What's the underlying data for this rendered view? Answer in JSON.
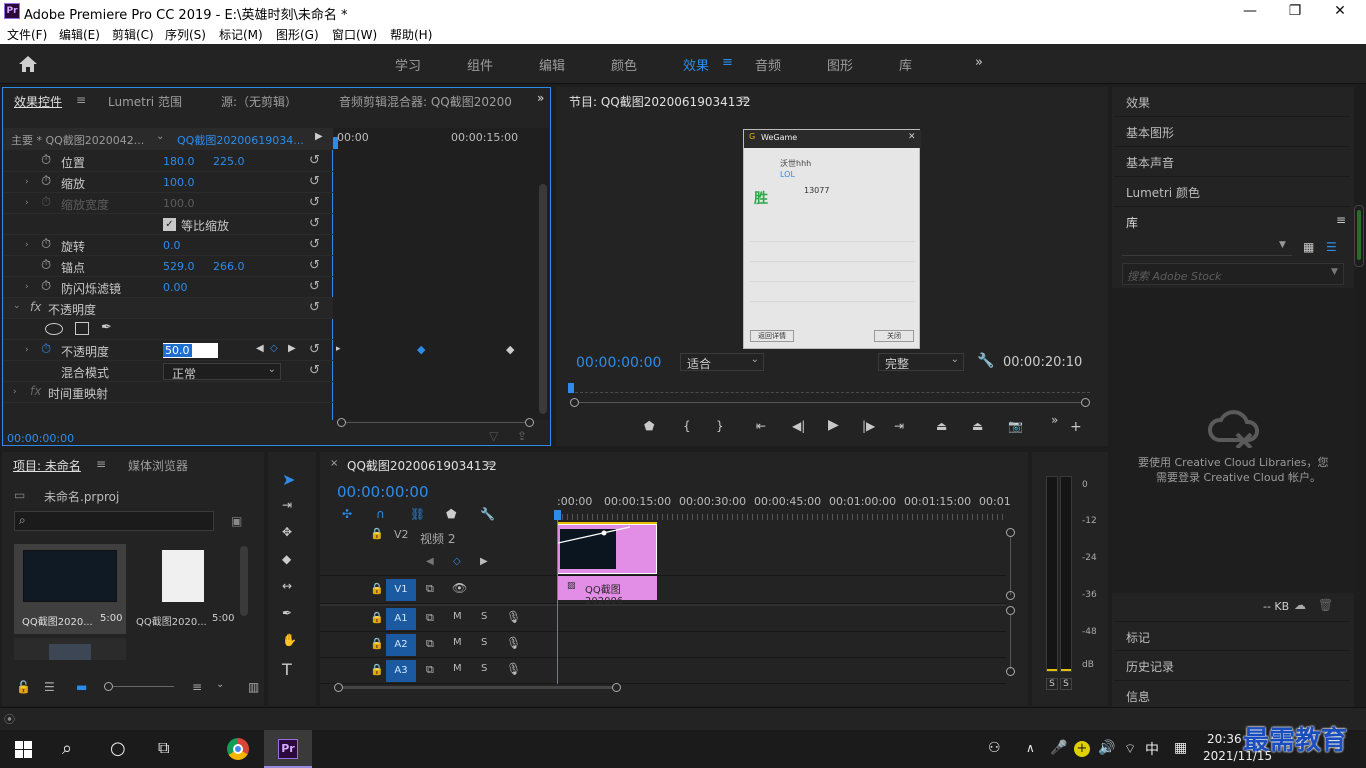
{
  "app": {
    "title": "Adobe Premiere Pro CC 2019 - E:\\英雄时刻\\未命名 *",
    "logo": "Pr"
  },
  "window": {
    "minimize": "—",
    "maximize": "❐",
    "close": "✕"
  },
  "menu": [
    "文件(F)",
    "编辑(E)",
    "剪辑(C)",
    "序列(S)",
    "标记(M)",
    "图形(G)",
    "窗口(W)",
    "帮助(H)"
  ],
  "workspaces": [
    "学习",
    "组件",
    "编辑",
    "颜色",
    "效果",
    "音频",
    "图形",
    "库"
  ],
  "workspace_active": "效果",
  "effect_controls": {
    "tabs": [
      "效果控件",
      "Lumetri 范围",
      "源:（无剪辑）",
      "音频剪辑混合器: QQ截图20200"
    ],
    "master": "主要 * QQ截图2020042...",
    "clip": "QQ截图20200619034...",
    "time_start": "00:00",
    "time_end": "00:00:15:00",
    "rows": [
      {
        "label": "位置",
        "v1": "180.0",
        "v2": "225.0"
      },
      {
        "label": "缩放",
        "v1": "100.0",
        "v2": ""
      },
      {
        "label": "缩放宽度",
        "v1": "100.0",
        "v2": ""
      },
      {
        "label": "等比缩放",
        "v1": "",
        "v2": ""
      },
      {
        "label": "旋转",
        "v1": "0.0",
        "v2": ""
      },
      {
        "label": "锚点",
        "v1": "529.0",
        "v2": "266.0"
      },
      {
        "label": "防闪烁滤镜",
        "v1": "0.00",
        "v2": ""
      }
    ],
    "opacity_section": "不透明度",
    "opacity_label": "不透明度",
    "opacity_value": "50.0",
    "blend_label": "混合模式",
    "blend_value": "正常",
    "time_remap": "时间重映射",
    "timecode": "00:00:00:00"
  },
  "program": {
    "title": "节目: QQ截图20200619034132",
    "timecode": "00:00:00:00",
    "fit": "适合",
    "quality": "完整",
    "duration": "00:00:20:10",
    "preview": {
      "app": "WeGame",
      "user": "沃世hhh",
      "mode": "LOL",
      "result": "胜",
      "score": "13077",
      "buttons": [
        "返回详情",
        "关闭"
      ]
    }
  },
  "right_panel": {
    "items": [
      "效果",
      "基本图形",
      "基本声音",
      "Lumetri 颜色",
      "库"
    ],
    "search_placeholder": "搜索 Adobe Stock",
    "cc_msg_line1": "要使用 Creative Cloud Libraries，您",
    "cc_msg_line2": "需要登录 Creative Cloud 帐户。",
    "kb": "-- KB",
    "bottom": [
      "标记",
      "历史记录",
      "信息"
    ]
  },
  "project": {
    "tabs": [
      "项目: 未命名",
      "媒体浏览器"
    ],
    "file": "未命名.prproj",
    "items": [
      {
        "name": "QQ截图2020...",
        "dur": "5:00"
      },
      {
        "name": "QQ截图2020...",
        "dur": "5:00"
      }
    ]
  },
  "timeline": {
    "title": "QQ截图20200619034132",
    "timecode": "00:00:00:00",
    "ruler": [
      ":00:00",
      "00:00:15:00",
      "00:00:30:00",
      "00:00:45:00",
      "00:01:00:00",
      "00:01:15:00",
      "00:01"
    ],
    "tracks": {
      "v2": "V2",
      "v2_name": "视频 2",
      "v1": "V1",
      "a1": "A1",
      "a2": "A2",
      "a3": "A3",
      "m": "M",
      "s": "S"
    },
    "clip_label": "QQ截图202006"
  },
  "meter": {
    "scale": [
      "0",
      "-12",
      "-24",
      "-36",
      "-48",
      "dB"
    ],
    "solo": "S"
  },
  "taskbar": {
    "time": "20:36",
    "date": "2021/11/15",
    "ime": "中",
    "watermark": "最需教育"
  },
  "colors": {
    "accent": "#2d8ceb",
    "clip": "#e38ee6",
    "track_btn": "#1b5aa0"
  }
}
